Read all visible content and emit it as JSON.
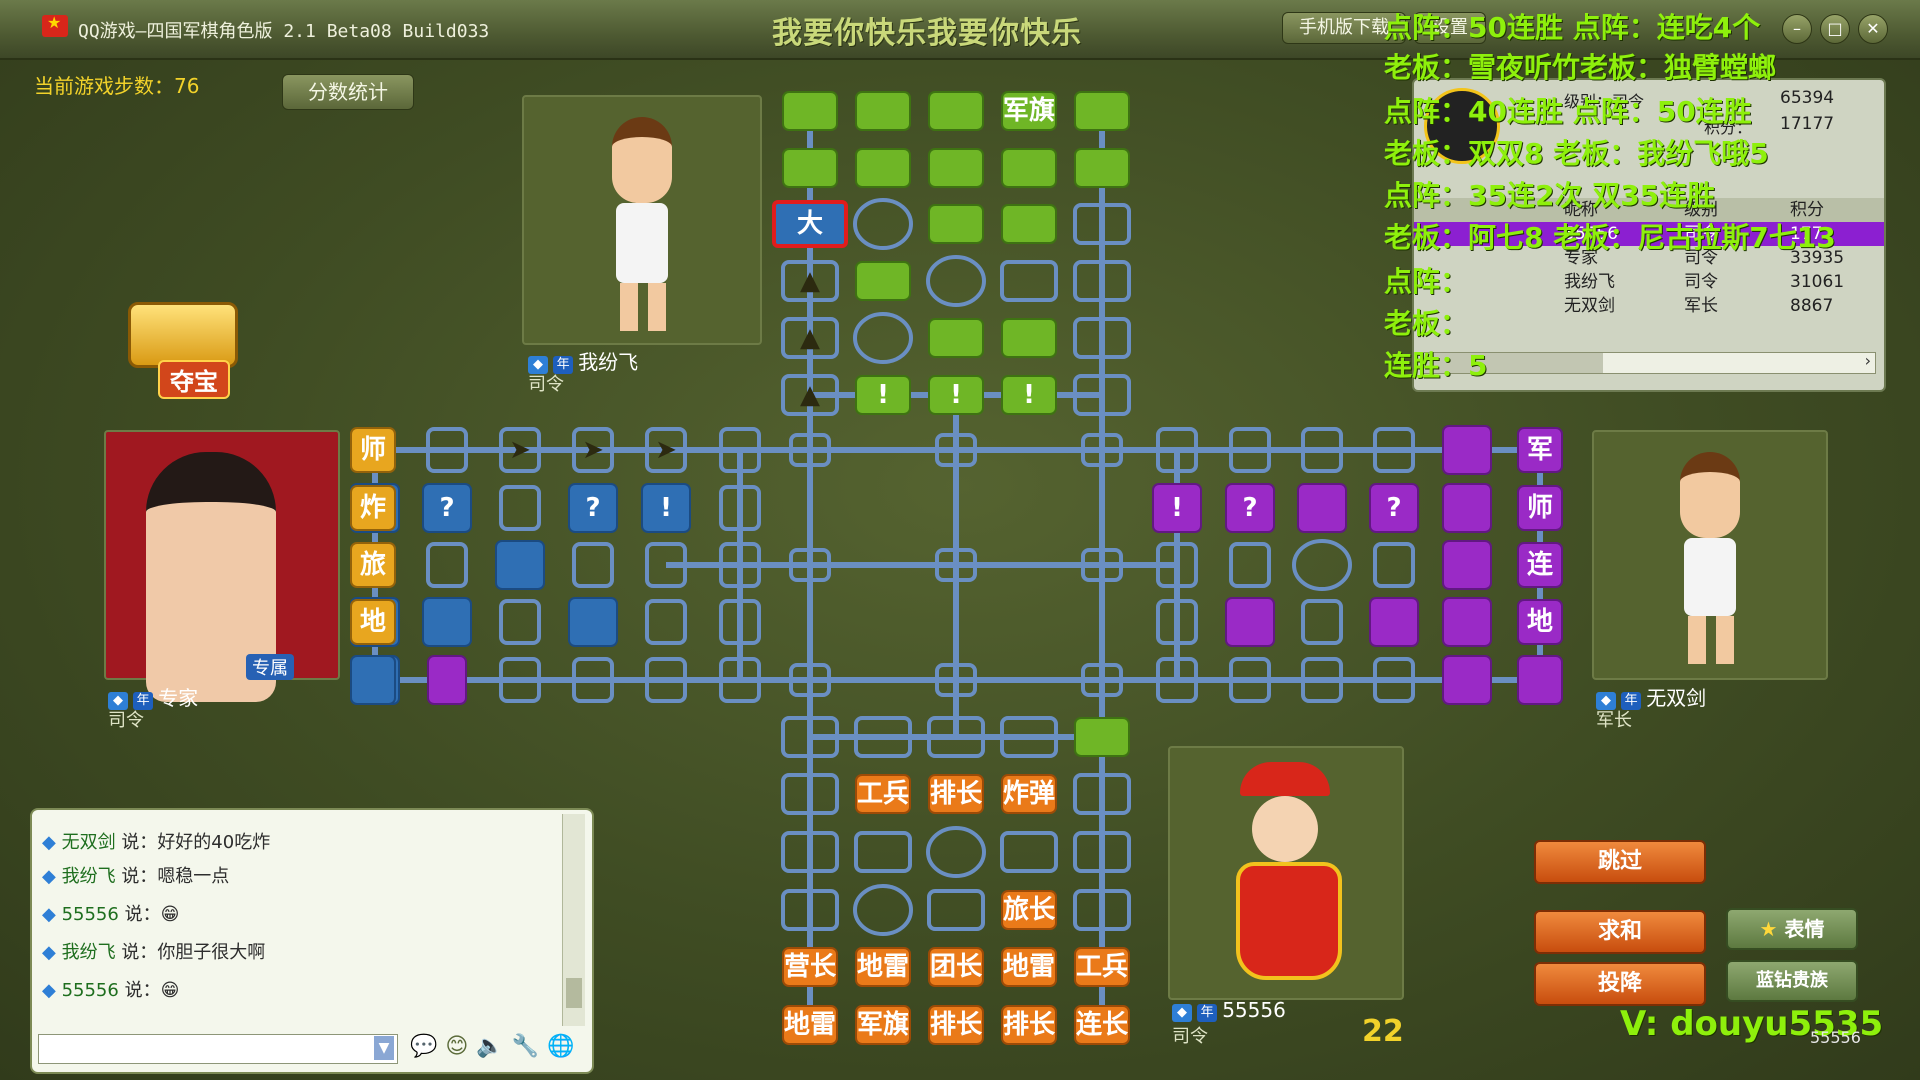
{
  "window": {
    "title": "QQ游戏—四国军棋角色版 2.1 Beta08 Build033",
    "marquee": "我要你快乐我要你快乐",
    "mobile_btn": "手机版下载",
    "settings_btn": "设置"
  },
  "game": {
    "steps_label": "当前游戏步数：",
    "steps_value": "76",
    "score_btn": "分数统计",
    "treasure_label": "夺宝",
    "timer": "22"
  },
  "players": {
    "top": {
      "name": "我纷飞",
      "rank": "司令",
      "badge": "年"
    },
    "left": {
      "name": "专家",
      "rank": "司令",
      "badge": "年",
      "tag": "专属"
    },
    "right": {
      "name": "无双剑",
      "rank": "军长",
      "badge": "年"
    },
    "bottom": {
      "name": "55556",
      "rank": "司令",
      "badge": "年"
    }
  },
  "board": {
    "top_pieces": [
      {
        "r": 0,
        "c": 3,
        "t": "军旗"
      },
      {
        "r": 2,
        "c": 0,
        "t": "大"
      },
      {
        "r": 3,
        "c": 0,
        "t": "▲"
      },
      {
        "r": 4,
        "c": 0,
        "t": "▲"
      },
      {
        "r": 5,
        "c": 0,
        "t": "▲"
      },
      {
        "r": 5,
        "c": 1,
        "t": "!"
      },
      {
        "r": 5,
        "c": 2,
        "t": "!"
      },
      {
        "r": 5,
        "c": 3,
        "t": "!"
      }
    ],
    "bottom_pieces": [
      {
        "r": 1,
        "c": 1,
        "t": "工兵"
      },
      {
        "r": 1,
        "c": 2,
        "t": "排长"
      },
      {
        "r": 1,
        "c": 3,
        "t": "炸弹"
      },
      {
        "r": 3,
        "c": 3,
        "t": "旅长"
      },
      {
        "r": 4,
        "c": 0,
        "t": "营长"
      },
      {
        "r": 4,
        "c": 1,
        "t": "地雷"
      },
      {
        "r": 4,
        "c": 2,
        "t": "团长"
      },
      {
        "r": 4,
        "c": 3,
        "t": "地雷"
      },
      {
        "r": 4,
        "c": 4,
        "t": "工兵"
      },
      {
        "r": 5,
        "c": 0,
        "t": "地雷"
      },
      {
        "r": 5,
        "c": 1,
        "t": "军旗"
      },
      {
        "r": 5,
        "c": 2,
        "t": "排长"
      },
      {
        "r": 5,
        "c": 3,
        "t": "排长"
      },
      {
        "r": 5,
        "c": 4,
        "t": "连长"
      }
    ],
    "left_marks": [
      {
        "r": 0,
        "c": 2,
        "t": "➤"
      },
      {
        "r": 0,
        "c": 3,
        "t": "➤"
      },
      {
        "r": 0,
        "c": 4,
        "t": "➤"
      },
      {
        "r": 1,
        "c": 1,
        "t": "?"
      },
      {
        "r": 1,
        "c": 3,
        "t": "?"
      },
      {
        "r": 1,
        "c": 4,
        "t": "!"
      }
    ],
    "left_labels": [
      "师",
      "炸",
      "旅",
      "地雷"
    ],
    "right_labels": [
      "军",
      "师",
      "连",
      "地雷"
    ],
    "right_marks": [
      {
        "r": 1,
        "c": 0,
        "t": "!"
      },
      {
        "r": 1,
        "c": 1,
        "t": "?"
      },
      {
        "r": 1,
        "c": 3,
        "t": "?"
      }
    ]
  },
  "score_table": {
    "headers": [
      "昵称",
      "级别",
      "积分"
    ],
    "top_values": [
      "65394",
      "17177"
    ],
    "top_labels": [
      "级别：司令",
      "积分："
    ],
    "rows": [
      {
        "name": "55556",
        "rank": "司令",
        "score": "177"
      },
      {
        "name": "专家",
        "rank": "司令",
        "score": "33935"
      },
      {
        "name": "我纷飞",
        "rank": "司令",
        "score": "31061"
      },
      {
        "name": "无双剑",
        "rank": "军长",
        "score": "8867"
      }
    ]
  },
  "chat": {
    "messages": [
      {
        "name": "无双剑",
        "says": "说：",
        "text": "好好的40吃炸"
      },
      {
        "name": "我纷飞",
        "says": "说：",
        "text": "嗯稳一点"
      },
      {
        "name": "55556",
        "says": "说：",
        "text": "😁"
      },
      {
        "name": "我纷飞",
        "says": "说：",
        "text": "你胆子很大啊"
      },
      {
        "name": "55556",
        "says": "说：",
        "text": "😁"
      }
    ]
  },
  "buttons": {
    "skip": "跳过",
    "draw": "求和",
    "surrender": "投降",
    "emote": "表情",
    "blue_diamond": "蓝钻贵族"
  },
  "overlay": {
    "lines": [
      "点阵：50连胜    点阵：连吃4个",
      "老板：雪夜听竹老板：独臂螳螂",
      "点阵：40连胜 点阵：50连胜",
      "老板：双双8  老板：我纷飞哦5",
      "点阵：35连2次 双35连胜",
      "老板：阿七8  老板：尼古拉斯7七13",
      "点阵：",
      "老板：",
      "连胜：5"
    ],
    "watermark": "V: douyu5535",
    "watermark_num": "55556"
  },
  "colors": {
    "green": "#6fb626",
    "blue": "#2f6fb4",
    "purple": "#9a2ac6",
    "orange": "#ea7a19",
    "overlay": "#8ef00c"
  }
}
